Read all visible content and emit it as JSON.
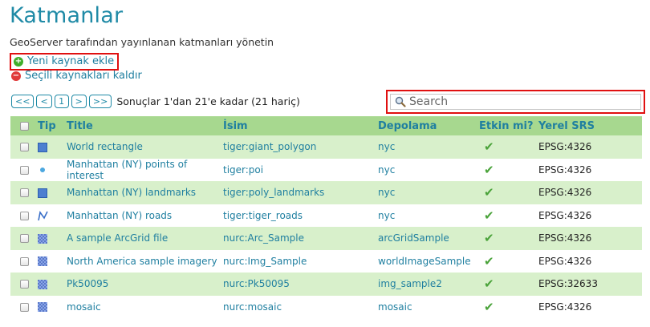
{
  "page": {
    "title": "Katmanlar",
    "description": "GeoServer tarafından yayınlanan katmanları yönetin"
  },
  "actions": {
    "add_label": "Yeni kaynak ekle",
    "remove_label": "Seçili kaynakları kaldır"
  },
  "pager": {
    "first": "<<",
    "prev": "<",
    "page": "1",
    "next": ">",
    "last": ">>",
    "results_text": "Sonuçlar 1'dan 21'e kadar (21 hariç)"
  },
  "search": {
    "placeholder": "Search"
  },
  "table": {
    "columns": {
      "type": "Tip",
      "title": "Title",
      "name": "İsim",
      "store": "Depolama",
      "enabled": "Etkin mi?",
      "srs": "Yerel SRS"
    },
    "enabled_mark": "✔",
    "rows": [
      {
        "icon": "polygon-icon",
        "title": "World rectangle",
        "name": "tiger:giant_polygon",
        "store": "nyc",
        "srs": "EPSG:4326"
      },
      {
        "icon": "point-icon",
        "title": "Manhattan (NY) points of interest",
        "name": "tiger:poi",
        "store": "nyc",
        "srs": "EPSG:4326"
      },
      {
        "icon": "polygon-icon",
        "title": "Manhattan (NY) landmarks",
        "name": "tiger:poly_landmarks",
        "store": "nyc",
        "srs": "EPSG:4326"
      },
      {
        "icon": "line-icon",
        "title": "Manhattan (NY) roads",
        "name": "tiger:tiger_roads",
        "store": "nyc",
        "srs": "EPSG:4326"
      },
      {
        "icon": "raster-icon",
        "title": "A sample ArcGrid file",
        "name": "nurc:Arc_Sample",
        "store": "arcGridSample",
        "srs": "EPSG:4326"
      },
      {
        "icon": "raster-icon",
        "title": "North America sample imagery",
        "name": "nurc:Img_Sample",
        "store": "worldImageSample",
        "srs": "EPSG:4326"
      },
      {
        "icon": "raster-icon",
        "title": "Pk50095",
        "name": "nurc:Pk50095",
        "store": "img_sample2",
        "srs": "EPSG:32633"
      },
      {
        "icon": "raster-icon",
        "title": "mosaic",
        "name": "nurc:mosaic",
        "store": "mosaic",
        "srs": "EPSG:4326"
      }
    ]
  },
  "colors": {
    "accent": "#1f8aa6",
    "header_bg": "#a7d88f",
    "row_alt_bg": "#d8f0cb",
    "highlight_border": "#e01010"
  }
}
